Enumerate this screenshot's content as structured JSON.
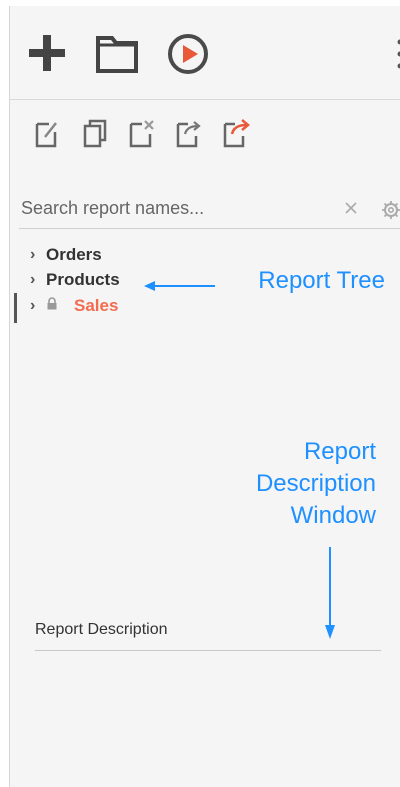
{
  "toolbar": {
    "primary": [
      {
        "icon": "plus-icon",
        "label": "New"
      },
      {
        "icon": "folder-icon",
        "label": "Folder"
      },
      {
        "icon": "play-circle-icon",
        "label": "Run"
      }
    ],
    "secondary_icons": [
      "edit-report-icon",
      "copy-report-icon",
      "delete-report-icon",
      "export-report-icon",
      "share-report-icon"
    ],
    "accent_play": "#e8593a",
    "accent_share": "#e8593a"
  },
  "search": {
    "placeholder": "Search report names..."
  },
  "tree": {
    "items": [
      {
        "label": "Orders",
        "locked": false,
        "color": "#333333"
      },
      {
        "label": "Products",
        "locked": false,
        "color": "#333333"
      },
      {
        "label": "Sales",
        "locked": true,
        "color": "#f26c4f"
      }
    ]
  },
  "annotations": {
    "report_tree": "Report Tree",
    "report_description_line1": "Report",
    "report_description_line2": "Description",
    "report_description_line3": "Window",
    "color": "#1e90ff"
  },
  "description": {
    "label": "Report Description"
  }
}
